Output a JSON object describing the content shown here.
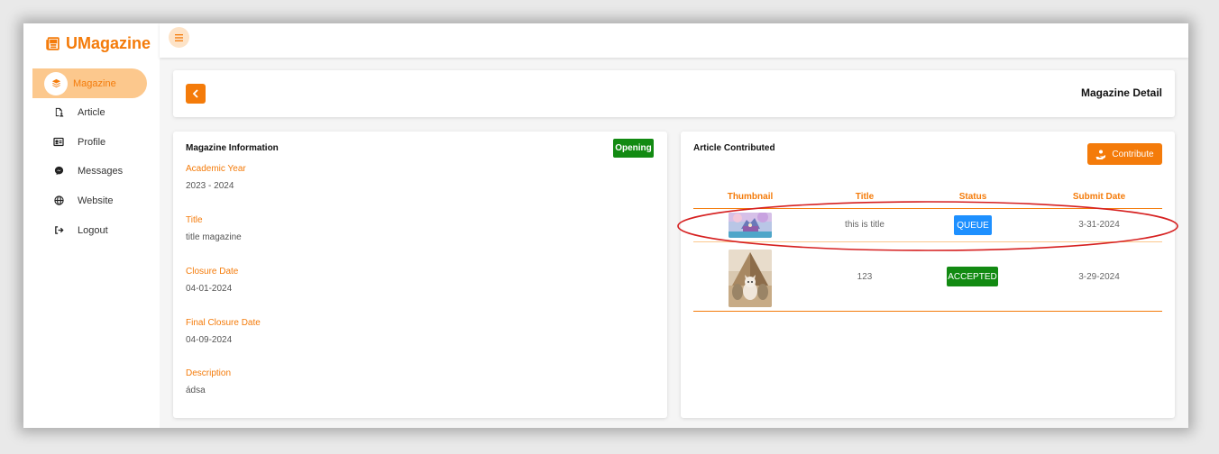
{
  "app": {
    "name": "UMagazine",
    "icon": "newspaper-icon",
    "accent_color": "#f47b0a"
  },
  "sidebar": {
    "items": [
      {
        "label": "Magazine",
        "icon": "layers-icon",
        "active": true
      },
      {
        "label": "Article",
        "icon": "file-user-icon"
      },
      {
        "label": "Profile",
        "icon": "id-card-icon"
      },
      {
        "label": "Messages",
        "icon": "messenger-icon"
      },
      {
        "label": "Website",
        "icon": "globe-icon"
      },
      {
        "label": "Logout",
        "icon": "logout-icon"
      }
    ]
  },
  "topbar": {
    "menu_icon": "hamburger-icon"
  },
  "header": {
    "back_icon": "chevron-left-icon",
    "title": "Magazine Detail"
  },
  "info": {
    "title": "Magazine Information",
    "badge": "Opening",
    "fields": [
      {
        "label": "Academic Year",
        "value": "2023 - 2024"
      },
      {
        "label": "Title",
        "value": "title magazine"
      },
      {
        "label": "Closure Date",
        "value": "04-01-2024"
      },
      {
        "label": "Final Closure Date",
        "value": "04-09-2024"
      },
      {
        "label": "Description",
        "value": "ádsa"
      }
    ]
  },
  "articles": {
    "title": "Article Contributed",
    "contribute_label": "Contribute",
    "columns": [
      "Thumbnail",
      "Title",
      "Status",
      "Submit Date"
    ],
    "rows": [
      {
        "title": "this is title",
        "status": "QUEUE",
        "date": "3-31-2024",
        "status_color": "#1e90ff"
      },
      {
        "title": "123",
        "status": "ACCEPTED",
        "date": "3-29-2024",
        "status_color": "#128a12"
      }
    ]
  },
  "colors": {
    "accent": "#f47b0a",
    "accent_light": "#fcc88d",
    "success": "#128a12",
    "info": "#1e90ff",
    "annotation": "#d62020"
  }
}
